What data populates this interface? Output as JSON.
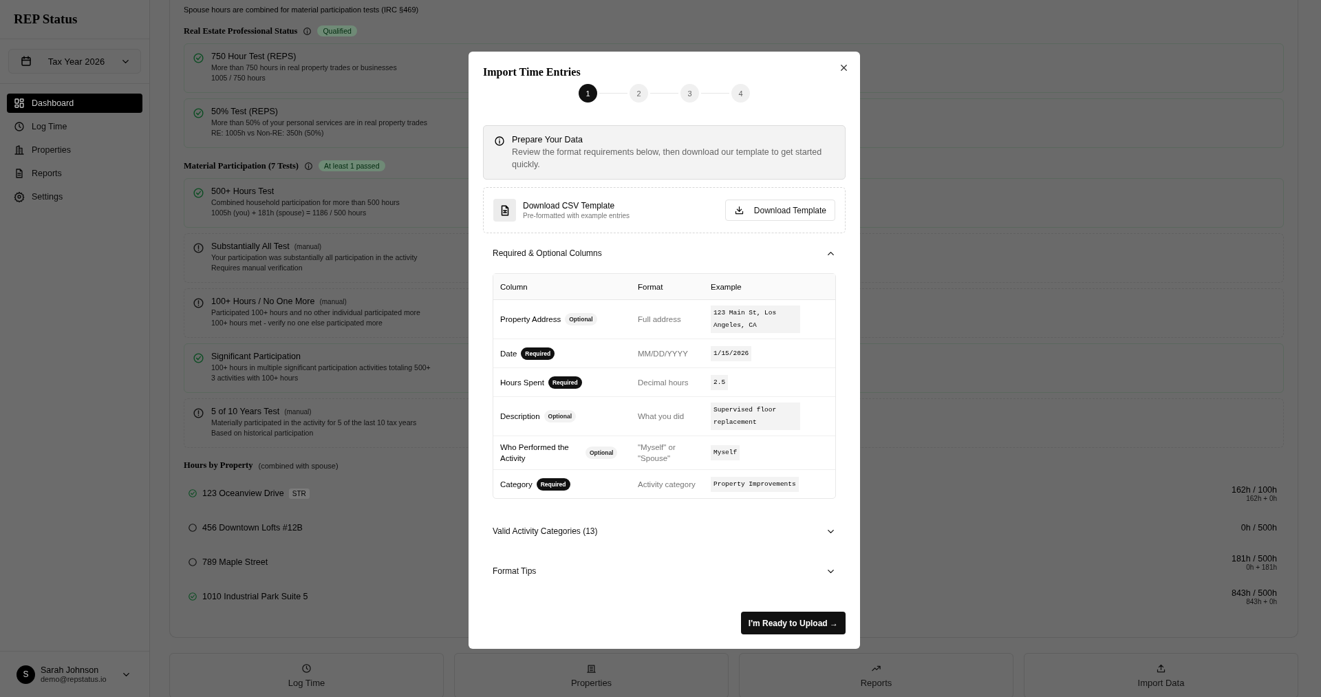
{
  "sidebar": {
    "title": "REP Status",
    "tax_year": "Tax Year 2026",
    "nav": [
      {
        "label": "Dashboard",
        "selected": true
      },
      {
        "label": "Log Time",
        "selected": false
      },
      {
        "label": "Properties",
        "selected": false
      },
      {
        "label": "Reports",
        "selected": false
      },
      {
        "label": "Settings",
        "selected": false
      }
    ],
    "user": {
      "initial": "S",
      "name": "Sarah Johnson",
      "email": "demo@repstatus.io"
    }
  },
  "main": {
    "note": "Spouse hours are combined for material participation tests (IRC §469)",
    "sections": [
      {
        "title": "Real Estate Professional Status",
        "badge": "Qualified",
        "tests": [
          {
            "passed": true,
            "title": "750 Hour Test (REPS)",
            "description": "More than 750 hours in real property trades or businesses",
            "detail": "1005 / 750 hours"
          },
          {
            "passed": true,
            "title": "50% Test (REPS)",
            "description": "More than 50% of your personal services are in real property trades",
            "detail": "RE: 1005h vs Non-RE: 350h (50%)"
          }
        ]
      },
      {
        "title": "Material Participation (7 Tests)",
        "badge": "At least 1 passed",
        "tests": [
          {
            "passed": true,
            "title": "500+ Hours Test",
            "description": "Combined household participation for more than 500 hours",
            "detail": "1005h (you) + 181h (spouse) = 1186 / 500 hours"
          },
          {
            "passed": false,
            "title": "Substantially All Test",
            "note": "(manual)",
            "description": "Your participation was substantially all participation in the activity",
            "detail": "Requires manual verification"
          },
          {
            "passed": false,
            "title": "100+ Hours / No One More",
            "note": "(manual)",
            "description": "Participated 100+ hours and no other individual participated more",
            "detail": "100+ hours met - verify no one else participated more"
          },
          {
            "passed": true,
            "title": "Significant Participation",
            "description": "100+ hours in multiple significant participation activities totaling 500+",
            "detail": "3 activities with 100+ hours"
          },
          {
            "passed": false,
            "title": "5 of 10 Years Test",
            "note": "(manual)",
            "description": "Materially participated in the activity for 5 of the last 10 tax years",
            "detail": "Based on historical participation"
          }
        ]
      }
    ],
    "properties": {
      "title": "Hours by Property",
      "subtitle": "(combined with spouse)",
      "rows": [
        {
          "name": "123 Oceanview Drive",
          "tag": "STR",
          "met": true,
          "hours": "162h / 100h",
          "breakdown": "162h + 0h"
        },
        {
          "name": "456 Downtown Lofts #12B",
          "met": false,
          "hours": "0h / 500h"
        },
        {
          "name": "789 Maple Street",
          "met": false,
          "hours": "181h / 500h",
          "breakdown": "0h + 181h"
        },
        {
          "name": "1010 Industrial Park Suite 5",
          "met": true,
          "hours": "843h / 500h",
          "breakdown": "843h + 0h"
        }
      ]
    },
    "quick_actions": [
      {
        "label": "Log Time"
      },
      {
        "label": "Properties"
      },
      {
        "label": "Reports"
      },
      {
        "label": "Import Data"
      }
    ]
  },
  "modal": {
    "title": "Import Time Entries",
    "steps": [
      {
        "label": "1",
        "selected": true
      },
      {
        "label": "2",
        "selected": false
      },
      {
        "label": "3",
        "selected": false
      },
      {
        "label": "4",
        "selected": false
      }
    ],
    "info": {
      "title": "Prepare Your Data",
      "text": "Review the format requirements below, then download our template to get started quickly."
    },
    "template": {
      "title": "Download CSV Template",
      "subtitle": "Pre-formatted with example entries",
      "button": "Download Template"
    },
    "sections": [
      {
        "title": "Required & Optional Columns",
        "expanded": true,
        "table": {
          "columns": [
            "Column",
            "Format",
            "Example"
          ],
          "rows": [
            {
              "column": "Property Address",
              "badge": "Optional",
              "required": false,
              "format": "Full address",
              "example": "123 Main St, Los Angeles, CA"
            },
            {
              "column": "Date",
              "badge": "Required",
              "required": true,
              "format": "MM/DD/YYYY",
              "example": "1/15/2026"
            },
            {
              "column": "Hours Spent",
              "badge": "Required",
              "required": true,
              "format": "Decimal hours",
              "example": "2.5"
            },
            {
              "column": "Description",
              "badge": "Optional",
              "required": false,
              "format": "What you did",
              "example": "Supervised floor replacement"
            },
            {
              "column": "Who Performed the Activity",
              "badge": "Optional",
              "required": false,
              "format": "\"Myself\" or \"Spouse\"",
              "example": "Myself"
            },
            {
              "column": "Category",
              "badge": "Required",
              "required": true,
              "format": "Activity category",
              "example": "Property Improvements"
            }
          ]
        }
      },
      {
        "title": "Valid Activity Categories (13)",
        "expanded": false
      },
      {
        "title": "Format Tips",
        "expanded": false
      }
    ],
    "primary_button": "I'm Ready to Upload →"
  }
}
